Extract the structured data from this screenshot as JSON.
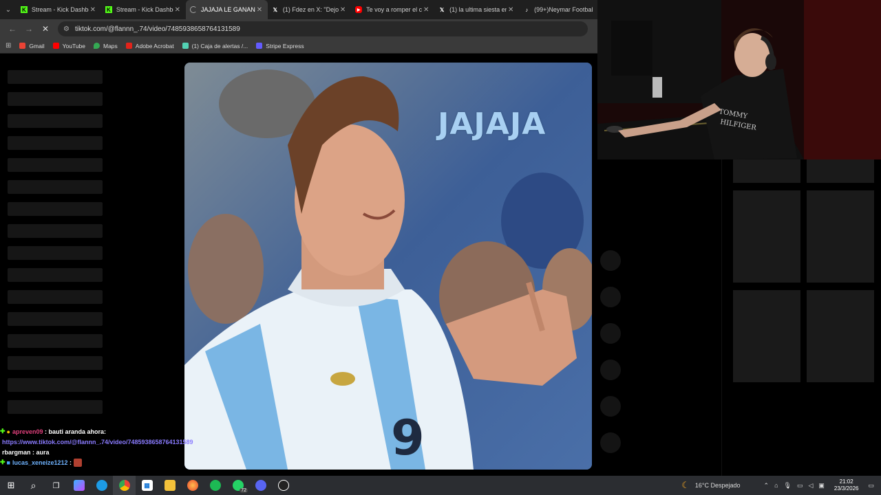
{
  "tabs": [
    {
      "title": "Stream - Kick Dashbo",
      "favicon": "kick-icon",
      "active": false
    },
    {
      "title": "Stream - Kick Dashbo",
      "favicon": "kick-icon",
      "active": false
    },
    {
      "title": "JAJAJA LE GANAN",
      "favicon": "loading-icon",
      "active": true
    },
    {
      "title": "(1) Fdez en X: \"Dejo",
      "favicon": "x-icon",
      "active": false
    },
    {
      "title": "Te voy a romper el c",
      "favicon": "youtube-icon",
      "active": false
    },
    {
      "title": "(1) la ultima siesta en",
      "favicon": "x-icon",
      "active": false
    },
    {
      "title": "(99+)Neymar Footbal",
      "favicon": "tiktok-icon",
      "active": false
    }
  ],
  "address": {
    "url": "tiktok.com/@flannn_.74/video/7485938658764131589"
  },
  "bookmarks": [
    {
      "label": "Gmail",
      "icon": "gmail-icon",
      "color": "#ea4335"
    },
    {
      "label": "YouTube",
      "icon": "youtube-icon",
      "color": "#ff0000"
    },
    {
      "label": "Maps",
      "icon": "maps-icon",
      "color": "#34a853"
    },
    {
      "label": "Adobe Acrobat",
      "icon": "acrobat-icon",
      "color": "#e2231a"
    },
    {
      "label": "(1) Caja de alertas /...",
      "icon": "alerts-icon",
      "color": "#53d2b4"
    },
    {
      "label": "Stripe Express",
      "icon": "stripe-icon",
      "color": "#635bff"
    }
  ],
  "video": {
    "overlay_text": "JAJAJA"
  },
  "chat": [
    {
      "user": "apreven09",
      "message": "bauti aranda ahora:",
      "user_color": "#e0407c"
    },
    {
      "user": "",
      "message": "https://www.tiktok.com/@flannn_.74/video/7485938658764131589",
      "user_color": "#8a7bff"
    },
    {
      "user": "rbargman",
      "message": "aura",
      "user_color": "#ffffff"
    },
    {
      "user": "lucas_xeneize1212",
      "message": "",
      "user_color": "#6fb3ff"
    }
  ],
  "taskbar": {
    "weather": "16°C  Despejado",
    "time": "21:02",
    "date": "23/3/2026",
    "whatsapp_badge": "72"
  }
}
